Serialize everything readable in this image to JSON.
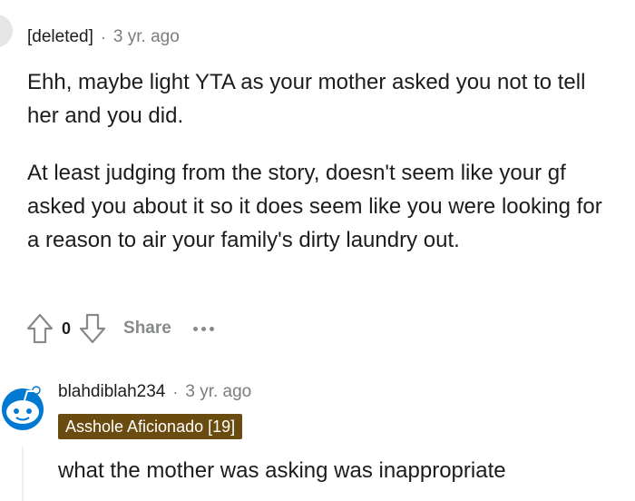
{
  "comment1": {
    "author": "[deleted]",
    "separator": "·",
    "time": "3 yr. ago",
    "paragraphs": [
      "Ehh, maybe light YTA as your mother asked you not to tell her and you did.",
      "At least judging from the story, doesn't seem like your gf asked you about it so it does seem like you were looking for a reason to air your family's dirty laundry out."
    ],
    "actions": {
      "vote_count": "0",
      "share_label": "Share",
      "upvote_icon": "upvote-arrow-icon",
      "downvote_icon": "downvote-arrow-icon",
      "more_icon": "ellipsis-icon"
    }
  },
  "comment2": {
    "author": "blahdiblah234",
    "separator": "·",
    "time": "3 yr. ago",
    "flair": "Asshole Aficionado [19]",
    "flair_color": "#6b4c10",
    "text": "what the mother was asking was inappropriate"
  }
}
